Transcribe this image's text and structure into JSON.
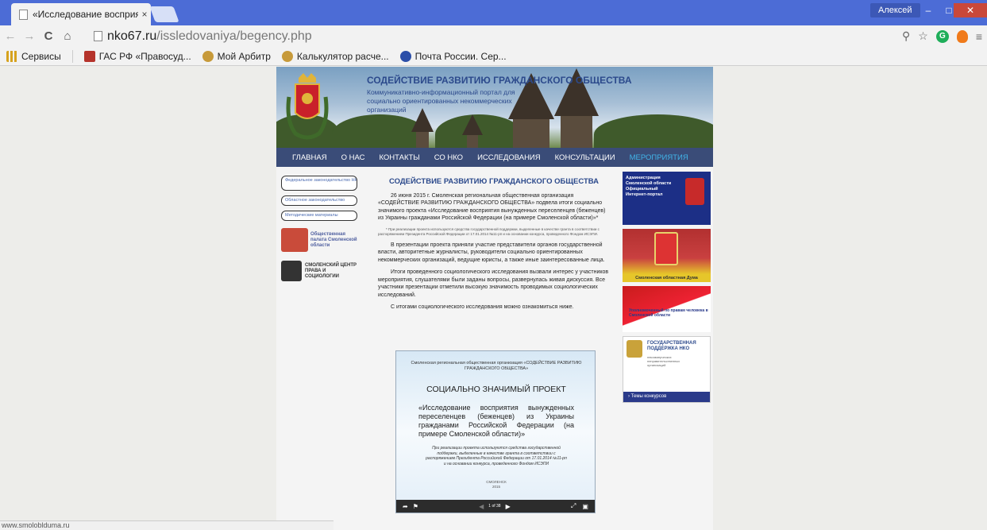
{
  "browser": {
    "tab_title": "«Исследование восприя",
    "tab_close": "×",
    "user": "Алексей",
    "win_minimize": "–",
    "win_maximize": "□",
    "win_close": "✕",
    "url_host": "nko67.ru",
    "url_path": "/issledovaniya/begency.php",
    "bookmarks": [
      {
        "label": "Сервисы",
        "color": "#d6a21e"
      },
      {
        "label": "ГАС РФ «Правосуд...",
        "color": "#b5332b"
      },
      {
        "label": "Мой Арбитр",
        "color": "#c79a3a"
      },
      {
        "label": "Калькулятор расче...",
        "color": "#c79a3a"
      },
      {
        "label": "Почта России. Сер...",
        "color": "#2b4ea8"
      }
    ]
  },
  "site": {
    "title": "СОДЕЙСТВИЕ РАЗВИТИЮ ГРАЖДАНСКОГО ОБЩЕСТВА",
    "subtitle": "Коммуникативно-информационный портал для социально ориентированных некоммерческих организаций",
    "nav": [
      "ГЛАВНАЯ",
      "О НАС",
      "КОНТАКТЫ",
      "СО НКО",
      "ИССЛЕДОВАНИЯ",
      "КОНСУЛЬТАЦИИ",
      "МЕРОПРИЯТИЯ"
    ],
    "left": {
      "links": [
        "Федеральное законодательство НКО",
        "Областное законодательство",
        "Методические материалы"
      ],
      "op_label": "Общественная палата Смоленской области",
      "sc_label": "СМОЛЕНСКИЙ ЦЕНТР ПРАВА И СОЦИОЛОГИИ"
    },
    "article": {
      "title": "СОДЕЙСТВИЕ РАЗВИТИЮ ГРАЖДАНСКОГО ОБЩЕСТВА",
      "p1": "26 июня 2015 г. Смоленская региональная общественная организация «СОДЕЙСТВИЕ РАЗВИТИЮ ГРАЖДАНСКОГО ОБЩЕСТВА» подвела итоги социально значимого проекта «Исследование восприятия вынужденных переселенцев (беженцев) из Украины гражданами Российской Федерации (на примере Смоленской области)»*",
      "note": "* При реализации проекта используются средства государственной поддержки, выделенные в качестве гранта в соответствии с распоряжением Президента Российской Федерации от 17.01.2014 №11-рп и на основании конкурса, проведенного Фондом ИСЭПИ.",
      "p2": "В презентации проекта приняли участие представители органов государственной власти, авторитетные журналисты, руководители социально ориентированных некоммерческих организаций, ведущие юристы, а также иные заинтересованные лица.",
      "p3": "Итоги проведенного социологического исследования вызвали интерес у участников мероприятия, слушателями были заданы вопросы, развернулась живая дискуссия. Все участники презентации отметили высокую значимость проводимых социологических исследований.",
      "p4": "С итогами социологического исследования можно ознакомиться ниже."
    },
    "presentation": {
      "org": "Смоленская региональная общественная организация «СОДЕЙСТВИЕ РАЗВИТИЮ ГРАЖДАНСКОГО ОБЩЕСТВА»",
      "heading": "СОЦИАЛЬНО ЗНАЧИМЫЙ ПРОЕКТ",
      "topic": "«Исследование восприятия вынужденных переселенцев (беженцев) из Украины гражданами Российской Федерации (на примере Смоленской области)»",
      "support": "При реализации проекта используются средства государственной поддержки, выделенные в качестве гранта в соответствии с распоряжением Президента Российской Федерации от 17.01.2014 №11-рп и на основании конкурса, проведенного Фондом ИСЭПИ",
      "city": "СМОЛЕНСК",
      "year": "2015",
      "page": "1 of 38"
    },
    "right": {
      "admin": "Администрация Смоленской области Официальный Интернет-портал",
      "duma": "Смоленская областная Дума",
      "ombudsman": "Уполномоченный по правам человека в Смоленской области",
      "support_title": "ГОСУДАРСТВЕННАЯ ПОДДЕРЖКА НКО",
      "support_sub": "некоммерческих неправительственных организаций",
      "support_link": "› Темы конкурсов"
    }
  },
  "status": "www.smoloblduma.ru"
}
